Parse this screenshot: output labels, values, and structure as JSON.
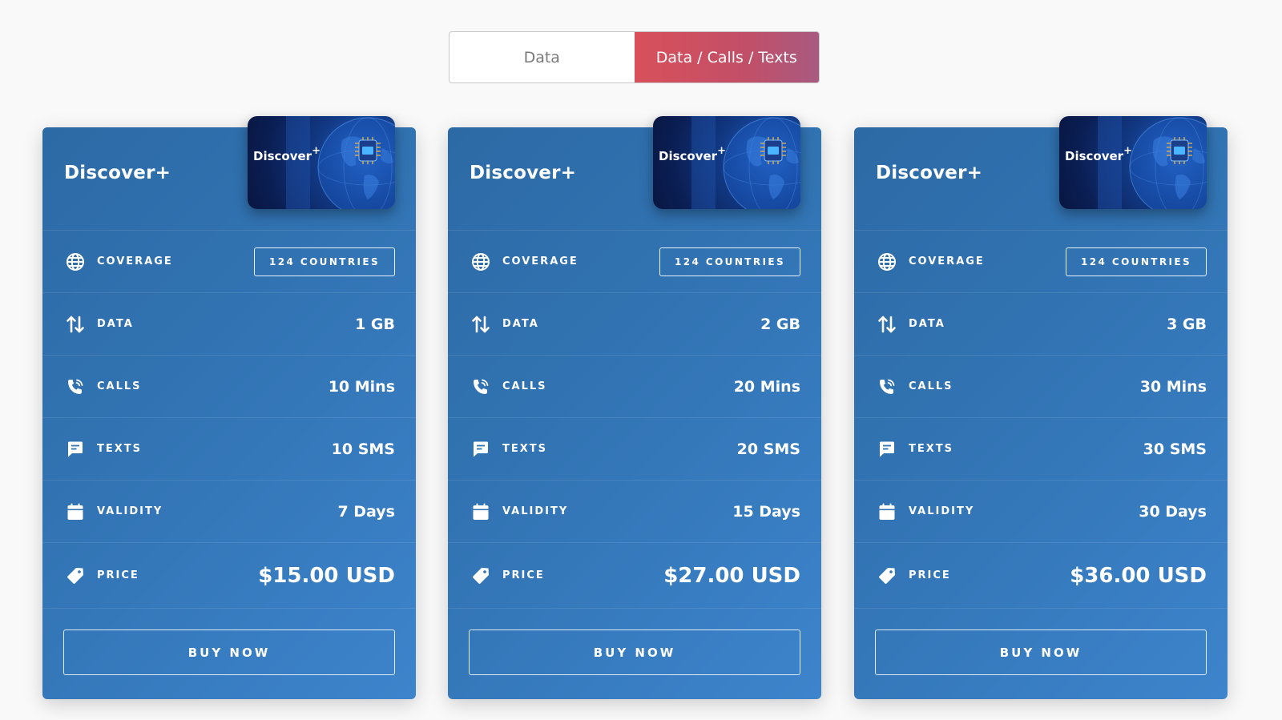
{
  "toggle": {
    "options": [
      "Data",
      "Data / Calls / Texts"
    ],
    "selected": "Data / Calls / Texts"
  },
  "labels": {
    "coverage": "COVERAGE",
    "data": "DATA",
    "calls": "CALLS",
    "texts": "TEXTS",
    "validity": "VALIDITY",
    "price": "PRICE",
    "buy": "BUY NOW"
  },
  "sim": {
    "brand": "Discover",
    "brand_mark": "+"
  },
  "plans": [
    {
      "title": "Discover+",
      "coverage": "124 COUNTRIES",
      "data": "1 GB",
      "calls": "10 Mins",
      "texts": "10 SMS",
      "validity": "7 Days",
      "price": "$15.00 USD"
    },
    {
      "title": "Discover+",
      "coverage": "124 COUNTRIES",
      "data": "2 GB",
      "calls": "20 Mins",
      "texts": "20 SMS",
      "validity": "15 Days",
      "price": "$27.00 USD"
    },
    {
      "title": "Discover+",
      "coverage": "124 COUNTRIES",
      "data": "3 GB",
      "calls": "30 Mins",
      "texts": "30 SMS",
      "validity": "30 Days",
      "price": "$36.00 USD"
    }
  ],
  "icons": {
    "coverage": "globe-icon",
    "data": "up-down-arrows-icon",
    "calls": "phone-icon",
    "texts": "message-icon",
    "validity": "calendar-icon",
    "price": "price-tag-icon"
  },
  "colors": {
    "card_start": "#2c6aa5",
    "card_end": "#3d84cc",
    "toggle_active_start": "#d8505a",
    "toggle_active_end": "#a85a80",
    "background": "#f9f9f9"
  }
}
